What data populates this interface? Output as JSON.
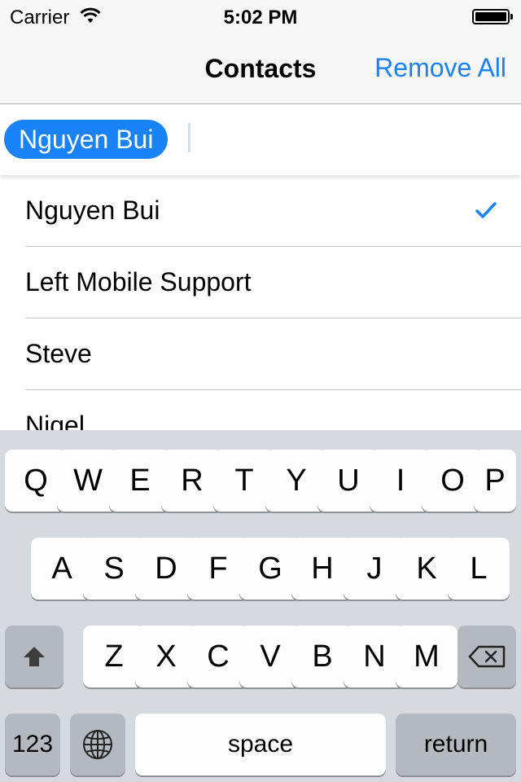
{
  "status_bar": {
    "carrier": "Carrier",
    "time": "5:02 PM"
  },
  "nav": {
    "title": "Contacts",
    "action_label": "Remove All"
  },
  "recipients": {
    "selected_token": "Nguyen Bui"
  },
  "contacts": [
    {
      "name": "Nguyen Bui",
      "checked": true
    },
    {
      "name": "Left Mobile Support",
      "checked": false
    },
    {
      "name": "Steve",
      "checked": false
    },
    {
      "name": "Nigel",
      "checked": false
    }
  ],
  "keyboard": {
    "row1": [
      "Q",
      "W",
      "E",
      "R",
      "T",
      "Y",
      "U",
      "I",
      "O",
      "P"
    ],
    "row2": [
      "A",
      "S",
      "D",
      "F",
      "G",
      "H",
      "J",
      "K",
      "L"
    ],
    "row3": [
      "Z",
      "X",
      "C",
      "V",
      "B",
      "N",
      "M"
    ],
    "numbers_label": "123",
    "space_label": "space",
    "return_label": "return",
    "icons": {
      "shift": "shift-arrow-icon",
      "delete": "backspace-icon",
      "globe": "globe-icon"
    }
  },
  "colors": {
    "accent": "#1a82f7",
    "keyboard_bg": "#d6d9dd",
    "special_key": "#b4b9c0"
  }
}
